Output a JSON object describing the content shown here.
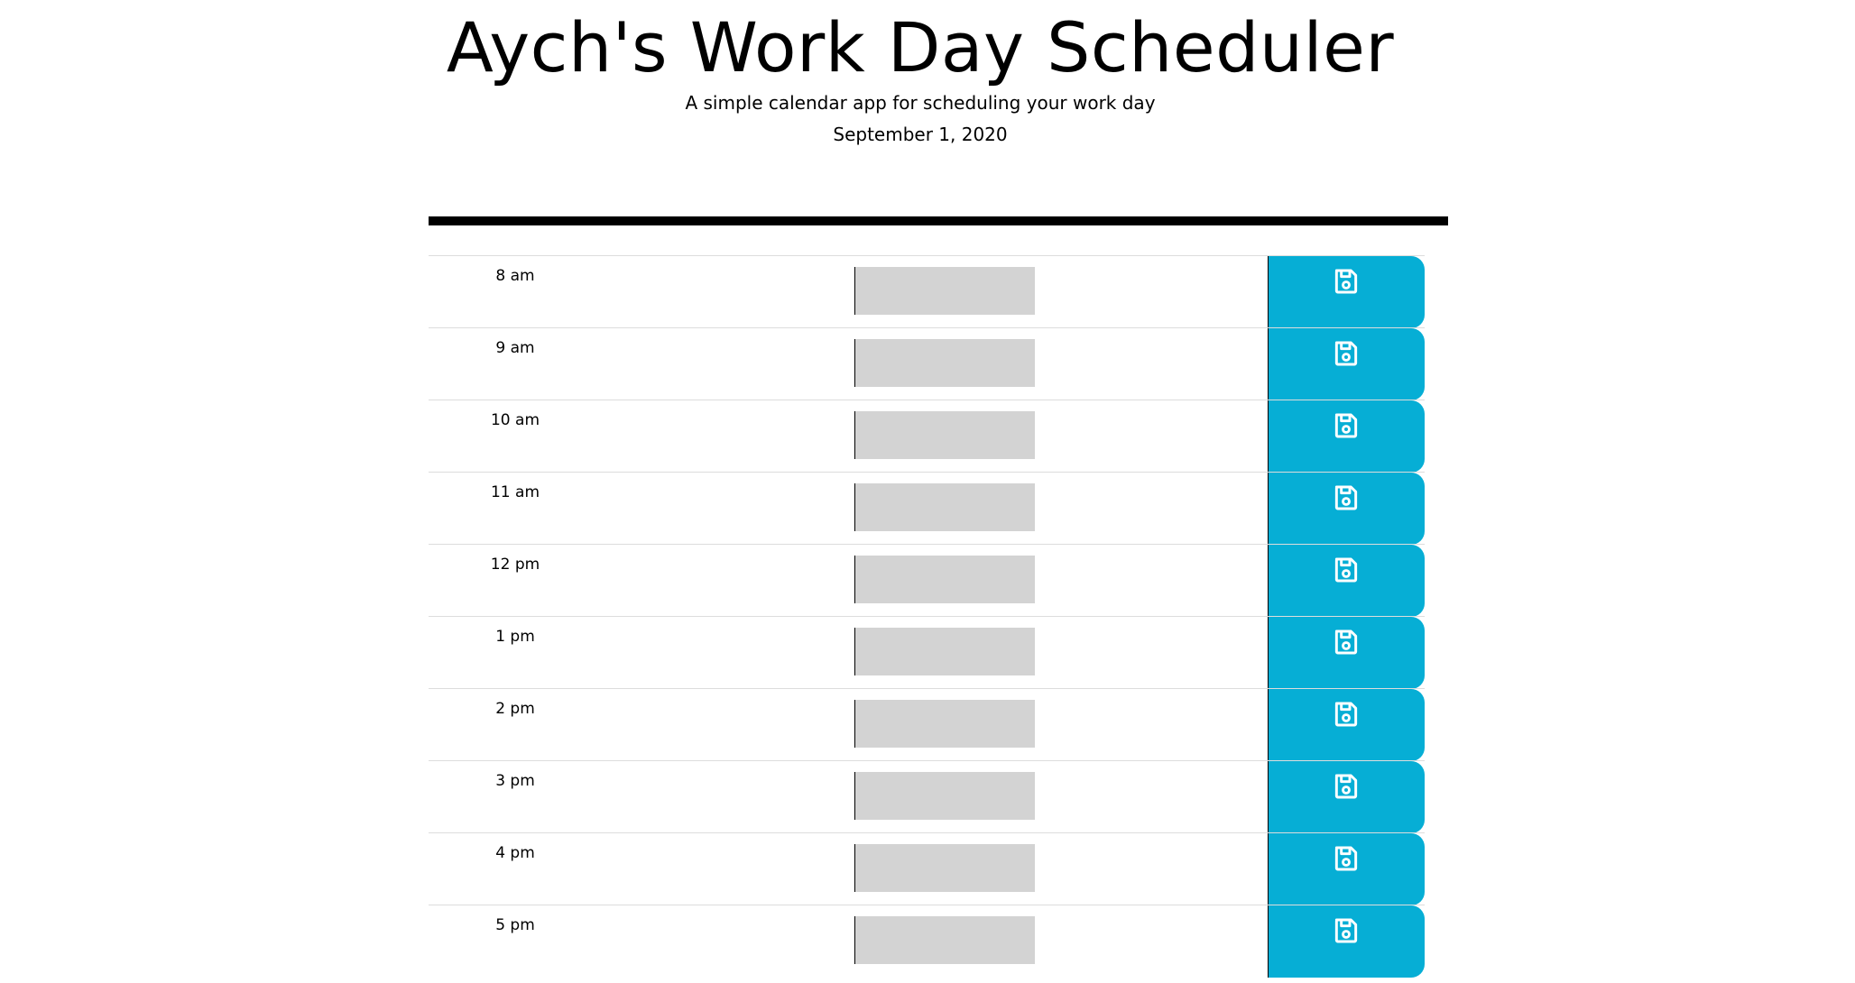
{
  "header": {
    "title": "Aych's Work Day Scheduler",
    "subtitle": "A simple calendar app for scheduling your work day",
    "current_date": "September 1, 2020"
  },
  "time_blocks": [
    {
      "hour": "8 am",
      "description": ""
    },
    {
      "hour": "9 am",
      "description": ""
    },
    {
      "hour": "10 am",
      "description": ""
    },
    {
      "hour": "11 am",
      "description": ""
    },
    {
      "hour": "12 pm",
      "description": ""
    },
    {
      "hour": "1 pm",
      "description": ""
    },
    {
      "hour": "2 pm",
      "description": ""
    },
    {
      "hour": "3 pm",
      "description": ""
    },
    {
      "hour": "4 pm",
      "description": ""
    },
    {
      "hour": "5 pm",
      "description": ""
    }
  ],
  "icons": {
    "save": "floppy-disk-save-icon"
  },
  "colors": {
    "save_button": "#06aed5",
    "past_block": "#d3d3d3",
    "divider": "#000000"
  }
}
